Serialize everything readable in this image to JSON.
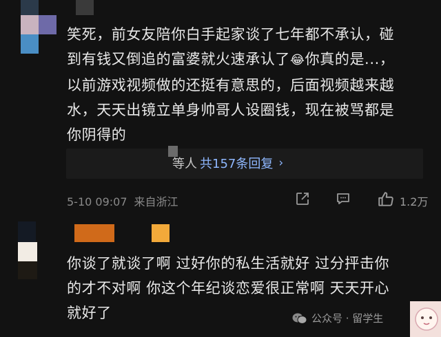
{
  "comments": [
    {
      "text": "笑死，前女友陪你白手起家谈了七年都不承认，碰\n到有钱又倒追的富婆就火速承认了",
      "emoji": "😂",
      "text_after_emoji": "你真的是...，",
      "text_rest": "以前游戏视频做的还挺有意思的，后面视频越来越\n水，天天出镜立单身帅哥人设圈钱，现在被骂都是\n你阴得的",
      "replies": {
        "prefix": "等人",
        "count_label": "共157条回复",
        "chevron": "›"
      },
      "date": "5-10 09:07",
      "location": "来自浙江",
      "like_count": "1.2万",
      "actions": [
        "share-icon",
        "comment-icon",
        "like-icon"
      ]
    },
    {
      "text": "你谈了就谈了啊 过好你的私生活就好 过分抨击你\n的才不对啊 你这个年纪谈恋爱很正常啊 天天开心\n就好了"
    }
  ],
  "watermark": {
    "icon": "wechat-official-icon",
    "text": "公众号 · 留学生"
  },
  "colors": {
    "background": "#121212",
    "link_blue": "#8fb8ff",
    "meta_gray": "#8a8a8a"
  }
}
